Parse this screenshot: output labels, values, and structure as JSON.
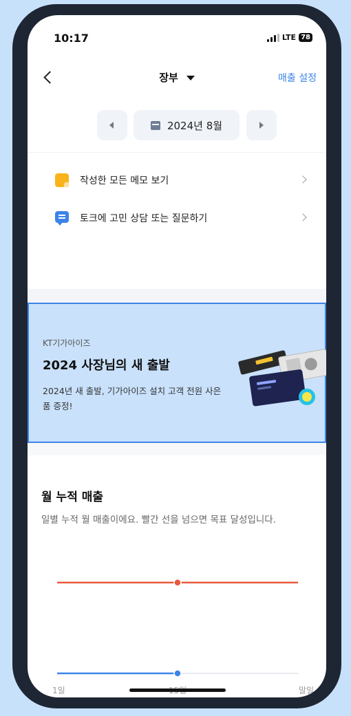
{
  "status_bar": {
    "time": "10:17",
    "network": "LTE",
    "battery": "78"
  },
  "header": {
    "title": "장부",
    "settings_link": "매출 설정"
  },
  "month_nav": {
    "label": "2024년 8월"
  },
  "menu": [
    {
      "label": "작성한 모든 메모 보기",
      "icon": "memo-icon"
    },
    {
      "label": "토크에 고민 상담 또는 질문하기",
      "icon": "chat-icon"
    }
  ],
  "banner": {
    "brand": "KT기가아이즈",
    "title": "2024 사장님의 새 출발",
    "description": "2024년 새 출발, 기가아이즈 설치 고객 전원 사은품 증정!"
  },
  "sales_section": {
    "title": "월 누적 매출",
    "description": "일별 누적 월 매출이에요. 빨간 선을 넘으면 목표 달성입니다."
  },
  "chart_data": {
    "type": "line",
    "x": [
      "1일",
      "15일",
      "말일"
    ],
    "series": [
      {
        "role": "target",
        "color": "#e8583a",
        "values": [
          1,
          1,
          1
        ]
      },
      {
        "role": "actual",
        "color": "#3c84e8",
        "values": [
          0,
          0,
          null
        ]
      }
    ],
    "marker_index": 1,
    "grid": false,
    "legend": "none"
  },
  "colors": {
    "accent": "#3c84e8",
    "target_line": "#e8583a",
    "banner_bg": "#c9e1fb",
    "device_frame": "#1e2634"
  }
}
